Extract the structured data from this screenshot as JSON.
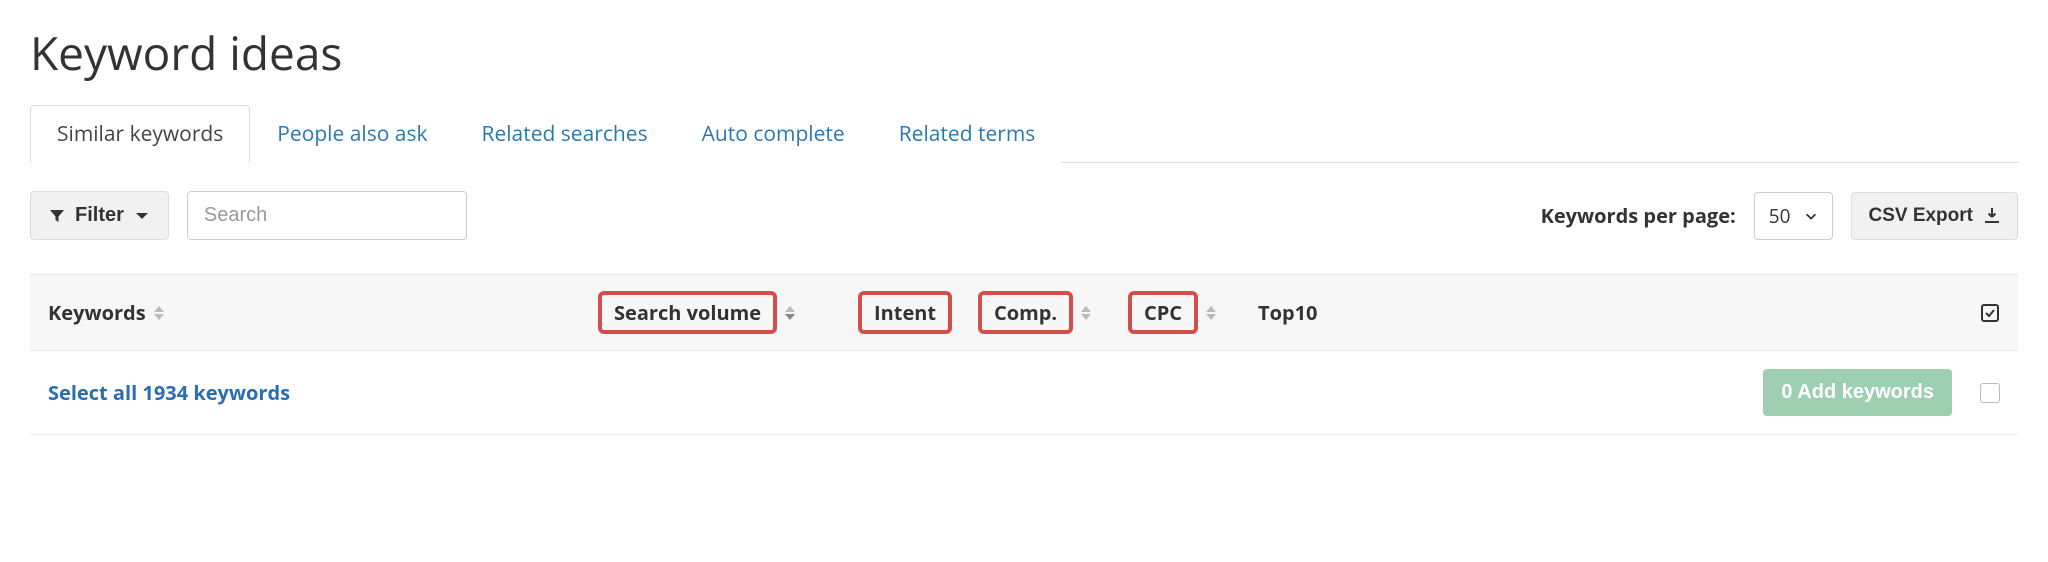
{
  "title": "Keyword ideas",
  "tabs": [
    {
      "label": "Similar keywords",
      "active": true
    },
    {
      "label": "People also ask",
      "active": false
    },
    {
      "label": "Related searches",
      "active": false
    },
    {
      "label": "Auto complete",
      "active": false
    },
    {
      "label": "Related terms",
      "active": false
    }
  ],
  "toolbar": {
    "filter_label": "Filter",
    "search_placeholder": "Search",
    "kpp_label": "Keywords per page:",
    "kpp_value": "50",
    "export_label": "CSV Export"
  },
  "columns": {
    "keywords": "Keywords",
    "search_volume": "Search volume",
    "intent": "Intent",
    "comp": "Comp.",
    "cpc": "CPC",
    "top10": "Top10"
  },
  "row": {
    "select_all_text": "Select all 1934 keywords",
    "add_button_label": "0 Add keywords"
  }
}
